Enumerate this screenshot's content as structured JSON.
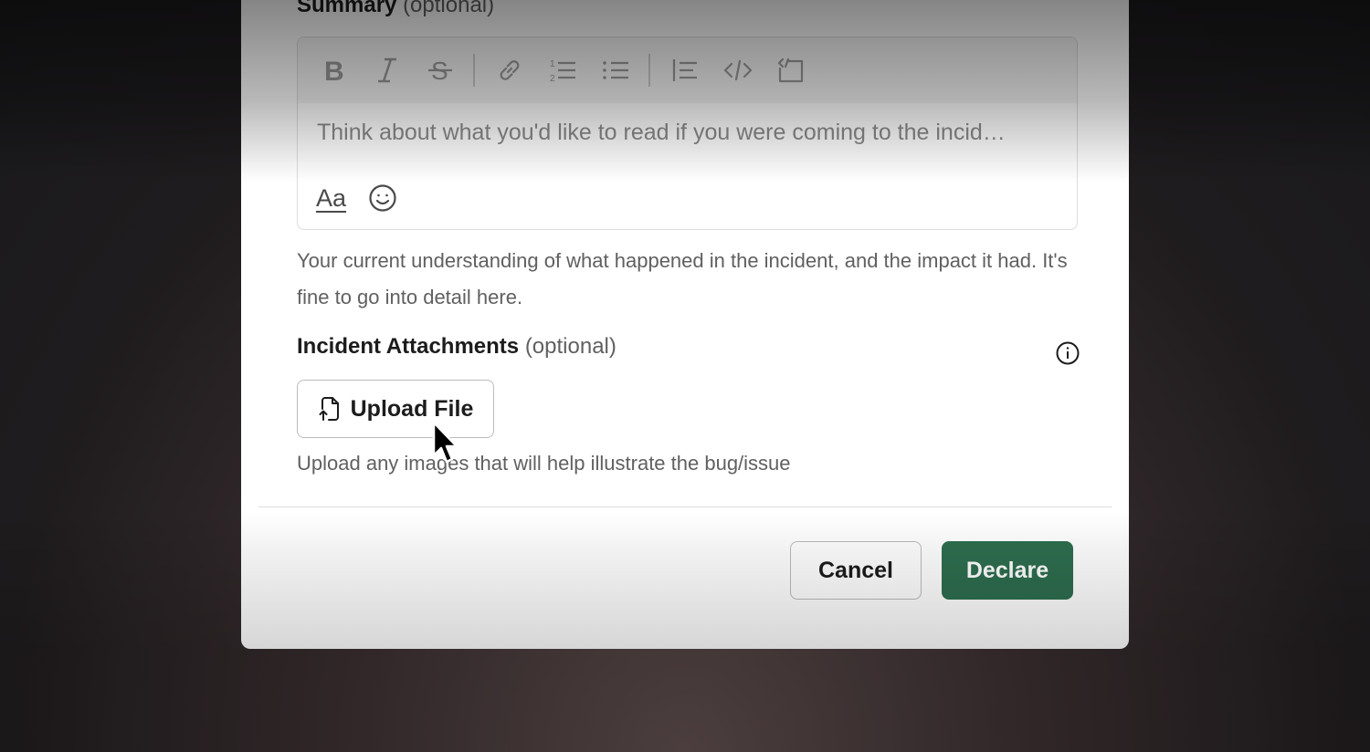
{
  "summary": {
    "label": "Summary",
    "optional": "(optional)",
    "placeholder": "Think about what you'd like to read if you were coming to the incid…",
    "help": "Your current understanding of what happened in the incident, and the impact it had. It's fine to go into detail here.",
    "toolbar": [
      "bold-icon",
      "italic-icon",
      "strikethrough-icon",
      "link-icon",
      "ordered-list-icon",
      "bullet-list-icon",
      "blockquote-icon",
      "code-icon",
      "code-block-icon"
    ],
    "format_label": "Aa"
  },
  "attachments": {
    "label": "Incident Attachments",
    "optional": "(optional)",
    "upload_label": "Upload File",
    "help": "Upload any images that will help illustrate the bug/issue"
  },
  "footer": {
    "cancel_label": "Cancel",
    "declare_label": "Declare"
  },
  "colors": {
    "primary": "#2e6e4f",
    "text": "#1d1c1d",
    "muted": "#616061"
  }
}
